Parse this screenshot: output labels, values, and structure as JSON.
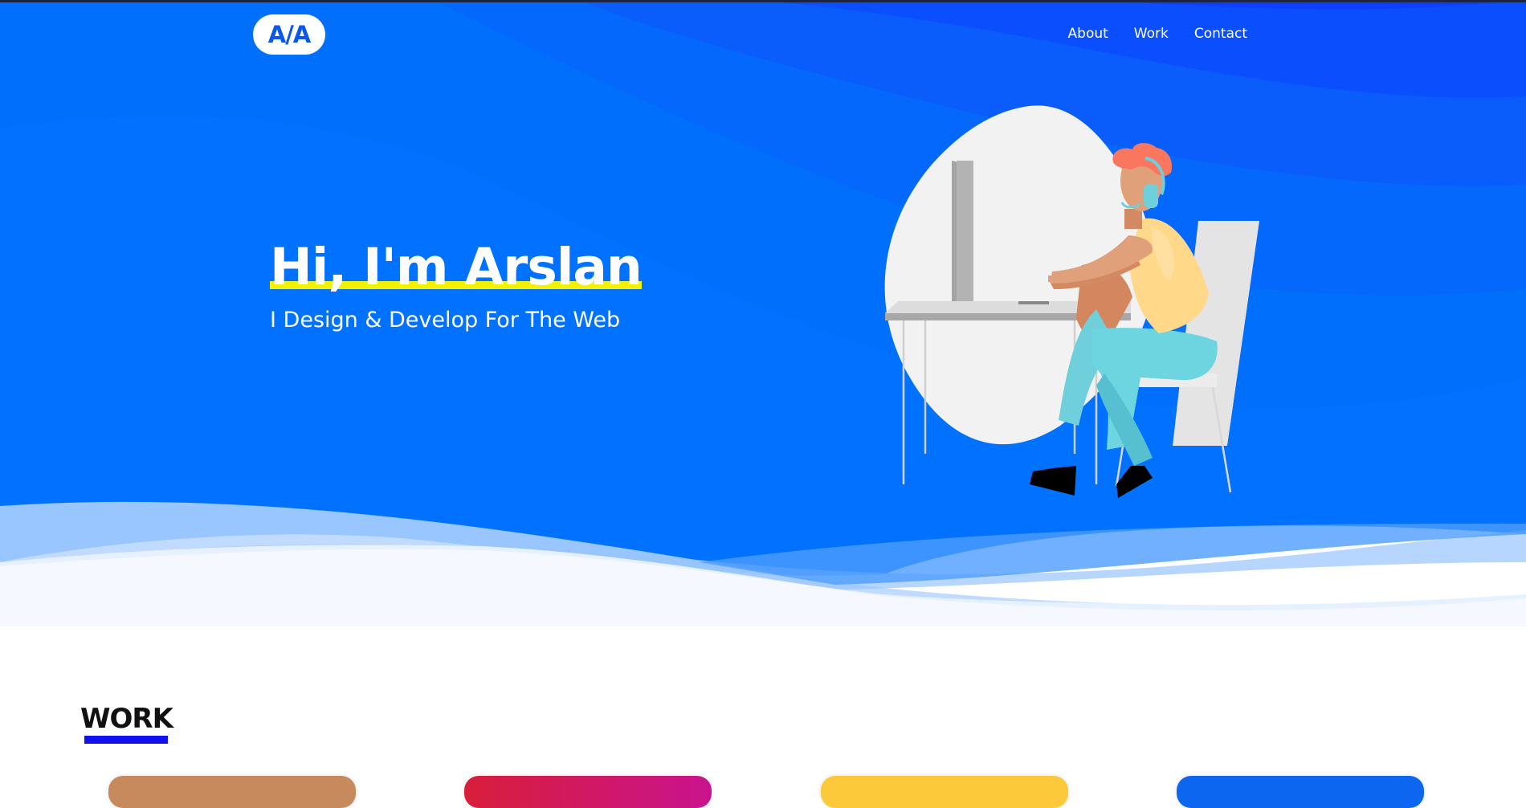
{
  "logo": {
    "text": "A/A"
  },
  "nav": {
    "items": [
      "About",
      "Work",
      "Contact"
    ]
  },
  "hero": {
    "title": "Hi, I'm Arslan",
    "subtitle": "I Design & Develop For The Web"
  },
  "work": {
    "heading": "WORK"
  },
  "colors": {
    "hero_blue": "#0072ff",
    "accent_yellow": "#f2f200",
    "work_underline": "#1010f0",
    "card_1": "#c68a5c",
    "card_2": "#d41e4f",
    "card_3": "#fbc93a",
    "card_4": "#0d66f0"
  },
  "illustration": {
    "icon": "person-at-desk-illustration"
  }
}
